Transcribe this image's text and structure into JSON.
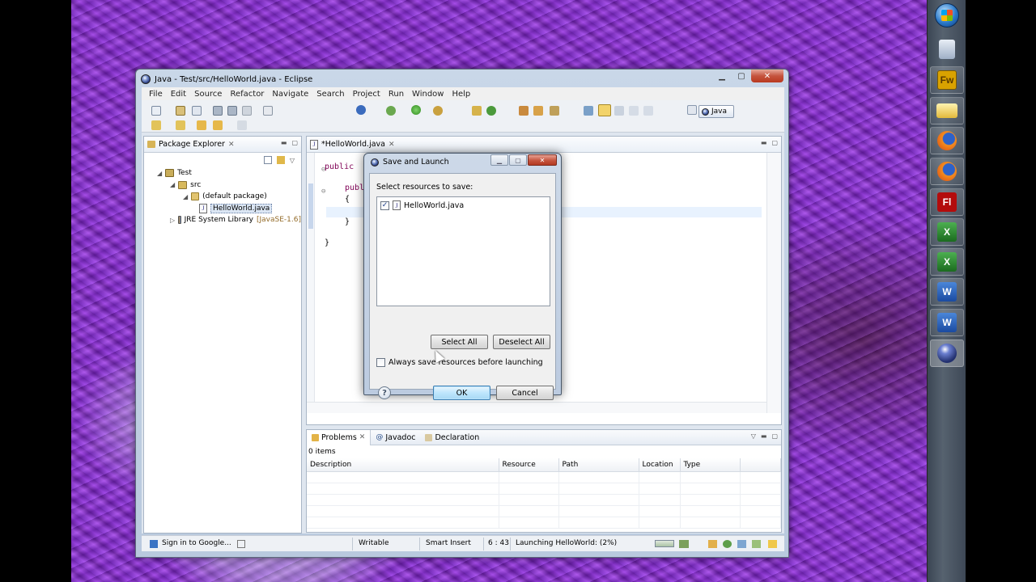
{
  "window": {
    "title": "Java - Test/src/HelloWorld.java - Eclipse",
    "controls": [
      "minimize",
      "maximize",
      "close"
    ]
  },
  "menu": [
    "File",
    "Edit",
    "Source",
    "Refactor",
    "Navigate",
    "Search",
    "Project",
    "Run",
    "Window",
    "Help"
  ],
  "perspective": {
    "label": "Java"
  },
  "package_explorer": {
    "tab_label": "Package Explorer",
    "tree": [
      {
        "label": "Test",
        "icon": "project-icon"
      },
      {
        "label": "src",
        "icon": "source-folder-icon"
      },
      {
        "label": "(default package)",
        "icon": "package-icon"
      },
      {
        "label": "HelloWorld.java",
        "icon": "java-file-icon"
      },
      {
        "label": "JRE System Library",
        "suffix": "[JavaSE-1.6]",
        "icon": "library-icon"
      }
    ]
  },
  "editor": {
    "tab_label": "*HelloWorld.java",
    "lines": [
      {
        "text": "public",
        "kind": "keyword"
      },
      {
        "text": "publ",
        "kind": "keyword"
      },
      {
        "text": "{",
        "kind": "plain"
      },
      {
        "text": "}",
        "kind": "plain"
      },
      {
        "text": "}",
        "kind": "plain"
      }
    ]
  },
  "bottom_views": {
    "tabs": [
      "Problems",
      "Javadoc",
      "Declaration"
    ],
    "items_count": "0 items",
    "columns": [
      "Description",
      "Resource",
      "Path",
      "Location",
      "Type"
    ]
  },
  "status_bar": {
    "sign_in": "Sign in to Google...",
    "writable": "Writable",
    "insert_mode": "Smart Insert",
    "position": "6 : 43",
    "launching": "Launching HelloWorld: (2%)",
    "progress": 0.02
  },
  "dialog": {
    "title": "Save and Launch",
    "label": "Select resources to save:",
    "resources": [
      {
        "name": "HelloWorld.java",
        "checked": true
      }
    ],
    "select_all": "Select All",
    "deselect_all": "Deselect All",
    "always_save": "Always save resources before launching",
    "always_save_checked": false,
    "ok": "OK",
    "cancel": "Cancel"
  },
  "taskbar": {
    "items": [
      "windows-start-icon",
      "computer-icon",
      "fireworks-icon",
      "folder-icon",
      "firefox-icon",
      "firefox-icon",
      "flash-icon",
      "excel-icon",
      "excel-icon",
      "word-icon",
      "word-icon",
      "eclipse-icon"
    ],
    "labels": {
      "fireworks": "Fw",
      "flash": "Fl"
    }
  }
}
